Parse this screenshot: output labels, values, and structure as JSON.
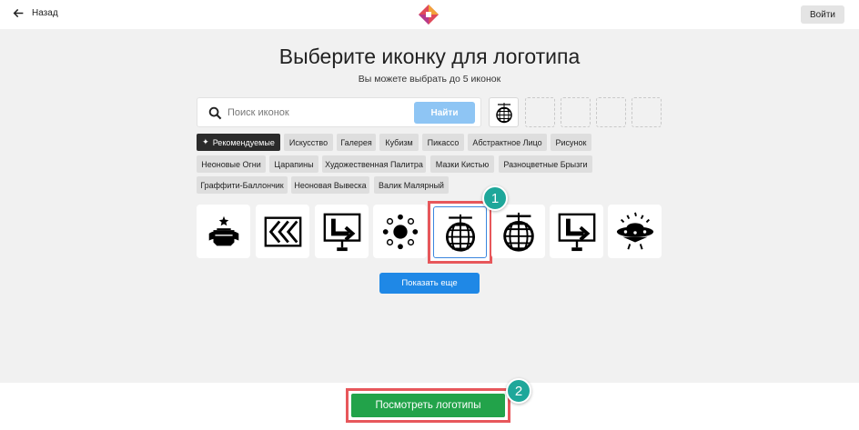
{
  "header": {
    "back_label": "Назад",
    "login_label": "Войти"
  },
  "main": {
    "title": "Выберите иконку для логотипа",
    "subtitle": "Вы можете выбрать до 5 иконок"
  },
  "search": {
    "placeholder": "Поиск иконок",
    "button_label": "Найти"
  },
  "categories": [
    "Рекомендуемые",
    "Искусство",
    "Галерея",
    "Кубизм",
    "Пикассо",
    "Абстрактное Лицо",
    "Рисунок",
    "Неоновые Огни",
    "Царапины",
    "Художественная Палитра",
    "Мазки Кистью",
    "Разноцветные Брызги",
    "Граффити-Баллончик",
    "Неоновая Вывеска",
    "Валик Малярный"
  ],
  "icons": [
    "vegas-sign-icon",
    "chevrons-left-icon",
    "sign-arrow-icon",
    "dots-circle-icon",
    "disco-ball-icon",
    "disco-ball-icon",
    "sign-arrow-icon",
    "ufo-icon"
  ],
  "show_more_label": "Показать еще",
  "view_logos_label": "Посмотреть логотипы",
  "badges": [
    "1",
    "2"
  ],
  "colors": {
    "accent_blue": "#1f88e6",
    "green": "#22a34a",
    "highlight_red": "#e7575b",
    "badge_teal": "#1ea79a"
  }
}
